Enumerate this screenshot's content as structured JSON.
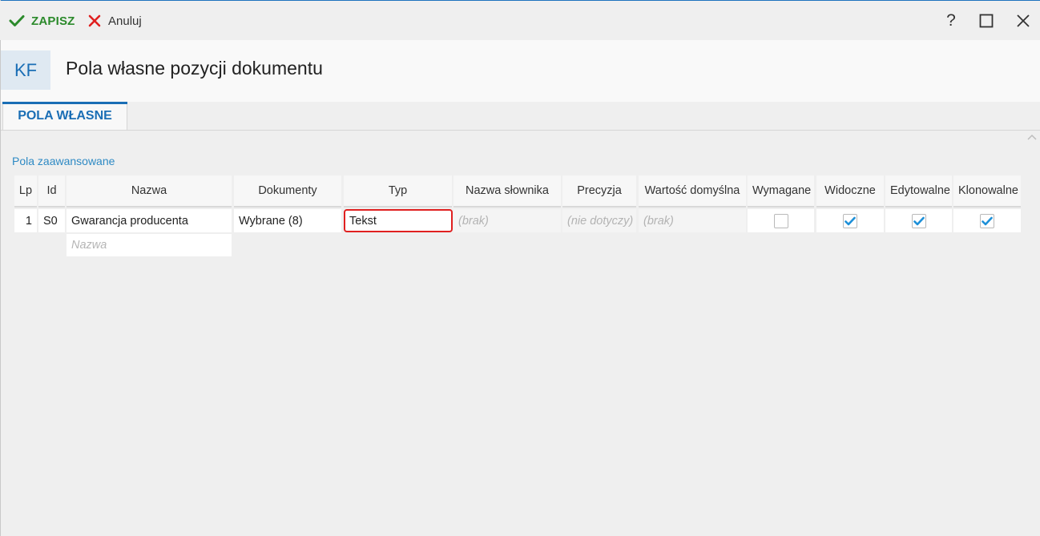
{
  "toolbar": {
    "save_label": "ZAPISZ",
    "cancel_label": "Anuluj",
    "help_label": "?"
  },
  "header": {
    "logo_text": "KF",
    "title": "Pola własne pozycji dokumentu"
  },
  "tabs": [
    {
      "label": "POLA WŁASNE",
      "active": true
    }
  ],
  "section_label": "Pola zaawansowane",
  "table": {
    "columns": [
      "Lp",
      "Id",
      "Nazwa",
      "Dokumenty",
      "Typ",
      "Nazwa słownika",
      "Precyzja",
      "Wartość domyślna",
      "Wymagane",
      "Widoczne",
      "Edytowalne",
      "Klonowalne"
    ],
    "rows": [
      {
        "lp": "1",
        "id": "S0",
        "nazwa": "Gwarancja producenta",
        "dokumenty": "Wybrane (8)",
        "typ": "Tekst",
        "nazwa_slownika": "(brak)",
        "precyzja": "(nie dotyczy)",
        "wartosc_domyslna": "(brak)",
        "wymagane": false,
        "widoczne": true,
        "edytowalne": true,
        "klonowalne": true
      }
    ],
    "new_row_placeholder": "Nazwa"
  },
  "colors": {
    "accent": "#1a6eb5",
    "save": "#2b8a2b",
    "cancel": "#e02020",
    "check": "#1e90d8"
  }
}
